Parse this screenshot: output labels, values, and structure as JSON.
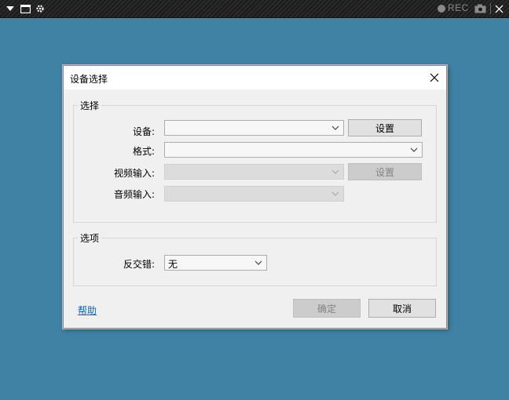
{
  "toolbar": {
    "menu_icon": "triangle-down-icon",
    "window_icon": "window-icon",
    "settings_icon": "settings-icon",
    "rec_label": "REC",
    "camera_icon": "camera-icon",
    "close_icon": "close-icon"
  },
  "dialog": {
    "title": "设备选择",
    "close_icon": "close-icon",
    "selection_group": {
      "title": "选择",
      "device_label": "设备:",
      "device_value": "",
      "device_settings_button": "设置",
      "format_label": "格式:",
      "format_value": "",
      "video_input_label": "视频输入:",
      "video_input_value": "",
      "video_settings_button": "设置",
      "audio_input_label": "音频输入:",
      "audio_input_value": ""
    },
    "options_group": {
      "title": "选项",
      "deinterlace_label": "反交错:",
      "deinterlace_value": "无"
    },
    "help_link": "帮助",
    "ok_button": "确定",
    "cancel_button": "取消"
  },
  "colors": {
    "desktop": "#3f82a4",
    "dialog_bg": "#f0f0f0",
    "link": "#0066cc"
  }
}
